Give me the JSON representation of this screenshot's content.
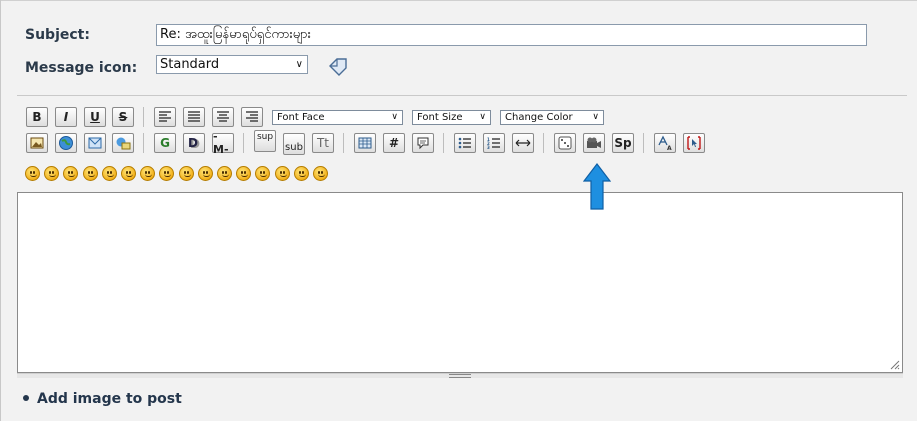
{
  "form": {
    "subject_label": "Subject:",
    "subject_value": "Re: အထူးမြန်မာရုပ်ရှင်ကားများ",
    "icon_label": "Message icon:",
    "icon_value": "Standard"
  },
  "toolbar": {
    "bold": "B",
    "italic": "I",
    "underline": "U",
    "strike": "S",
    "font_face": "Font Face",
    "font_size": "Font Size",
    "change_color": "Change Color",
    "glow": "G",
    "move": "M",
    "sup": "sup",
    "sub": "sub",
    "tt": "Tt",
    "hash": "#",
    "spoiler": "Sp"
  },
  "smileys": [
    "smile",
    "wink",
    "cheesy",
    "grin",
    "angry",
    "sad",
    "shocked",
    "cool",
    "huh",
    "rolleyes",
    "tongue",
    "embarrassed",
    "lipsrsealed",
    "undecided",
    "kiss",
    "cry"
  ],
  "footer": {
    "add_image_label": "Add image to post"
  },
  "colors": {
    "accent_arrow": "#1e8fe0",
    "label_text": "#2b3a4a"
  }
}
